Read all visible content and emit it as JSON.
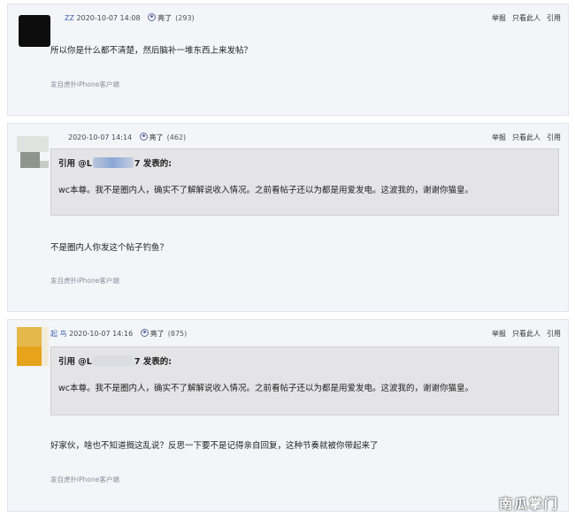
{
  "posts": [
    {
      "user": "ZZ",
      "date": "2020-10-07 14:08",
      "light_label": "亮了",
      "light_count": "(293)",
      "body": "所以你是什么都不清楚，然后脑补一堆东西上来发帖？",
      "source": "发自虎扑iPhone客户端"
    },
    {
      "user": "",
      "date": "2020-10-07 14:14",
      "light_label": "亮了",
      "light_count": "(462)",
      "quote_prefix": "引用 @L",
      "quote_suffix": "7 发表的:",
      "quote_text": "wc本尊。我不是圈内人，确实不了解解说收入情况。之前看帖子还以为都是用爱发电。这波我的，谢谢你猫皇。",
      "body": "不是圈内人你发这个帖子钓鱼？",
      "source": "发自虎扑iPhone客户端"
    },
    {
      "user": "起 鸟",
      "date": "2020-10-07 14:16",
      "light_label": "亮了",
      "light_count": "(875)",
      "quote_prefix": "引用 @L",
      "quote_suffix": "7 发表的:",
      "quote_text": "wc本尊。我不是圈内人，确实不了解解说收入情况。之前看帖子还以为都是用爱发电。这波我的，谢谢你猫皇。",
      "body": "好家伙，啥也不知道搁这乱说？反思一下要不是记得亲自回复，这种节奏就被你带起来了",
      "source": "发自虎扑iPhone客户端"
    }
  ],
  "actions": {
    "report": "举报",
    "only_this": "只看此人",
    "quote": "引用"
  },
  "watermark": "南瓜掌门"
}
